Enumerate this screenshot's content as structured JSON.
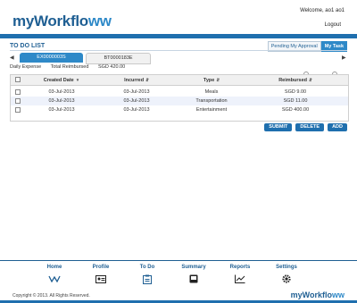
{
  "header": {
    "logo_text": "myWorkflo",
    "logo_waves": "ᴡᴡ",
    "welcome": "Welcome, ao1 ao1",
    "logout": "Logout"
  },
  "page": {
    "title": "TO DO LIST",
    "filters": [
      "Pending My Approval",
      "My Task"
    ],
    "active_filter": "My Task"
  },
  "tabs": [
    {
      "label": "EX0000003S",
      "active": true
    },
    {
      "label": "BT0000183E",
      "active": false
    }
  ],
  "summary": {
    "type": "Daily Expense",
    "reimbursed_label": "Total Reimbursed",
    "reimbursed_value": "SGD 420.00"
  },
  "table": {
    "columns": [
      "",
      "Created Date",
      "Incurred",
      "Type",
      "Reimbursed"
    ],
    "rows": [
      {
        "created": "03-Jul-2013",
        "incurred": "03-Jul-2013",
        "type": "Meals",
        "reimbursed": "SGD 9.00"
      },
      {
        "created": "03-Jul-2013",
        "incurred": "03-Jul-2013",
        "type": "Transportation",
        "reimbursed": "SGD 11.00"
      },
      {
        "created": "03-Jul-2013",
        "incurred": "03-Jul-2013",
        "type": "Entertainment",
        "reimbursed": "SGD 400.00"
      }
    ]
  },
  "actions": {
    "submit": "SUBMIT",
    "delete": "DELETE",
    "add": "ADD"
  },
  "nav": [
    {
      "label": "Home",
      "icon": "home-wave-icon"
    },
    {
      "label": "Profile",
      "icon": "profile-card-icon"
    },
    {
      "label": "To Do",
      "icon": "clipboard-icon"
    },
    {
      "label": "Summary",
      "icon": "book-icon"
    },
    {
      "label": "Reports",
      "icon": "line-chart-icon"
    },
    {
      "label": "Settings",
      "icon": "gear-icon"
    }
  ],
  "footer": {
    "copyright": "Copyright © 2013. All Rights Reserved.",
    "logo_text": "myWorkflo",
    "logo_waves": "ᴡᴡ"
  },
  "colors": {
    "primary": "#1f6fae",
    "accent": "#2e89c8",
    "dark_blue": "#1f5f93"
  }
}
